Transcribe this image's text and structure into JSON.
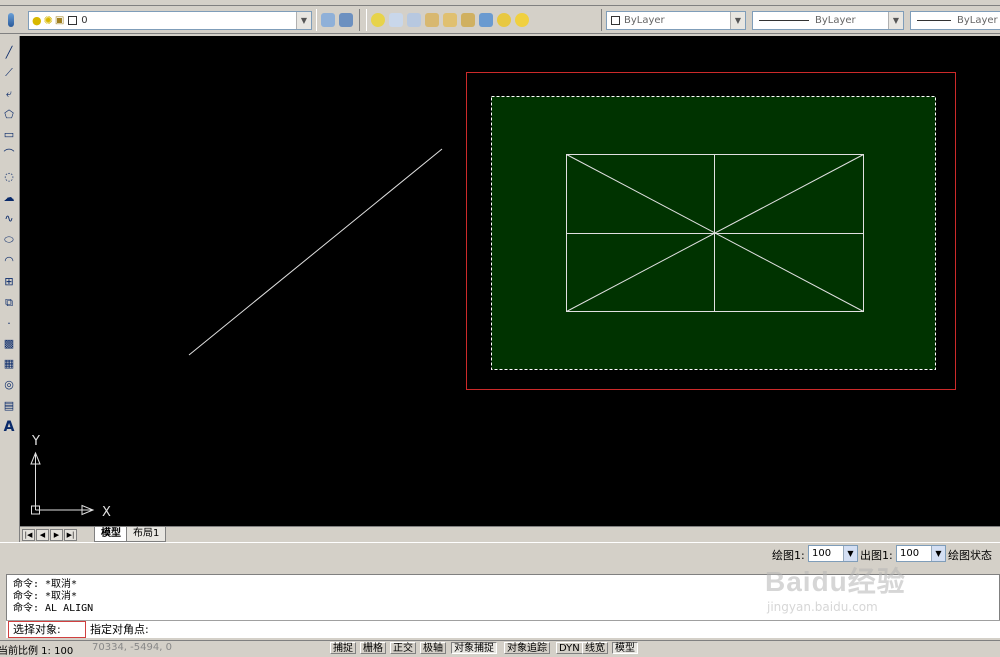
{
  "toolbar": {
    "layer_value": "0",
    "color_value": "ByLayer",
    "linetype_value": "ByLayer",
    "lineweight_value": "ByLayer"
  },
  "canvas": {
    "ucs_x_label": "X",
    "ucs_y_label": "Y",
    "colors": {
      "background": "#000000",
      "viewport_fill": "#003300",
      "paper_border": "#cc2a2a",
      "lines": "#e0e0e0"
    }
  },
  "layout_tabs": [
    {
      "label": "模型"
    },
    {
      "label": "布局1"
    }
  ],
  "viewport_bar": {
    "draw_label": "绘图1:",
    "draw_scale": "100",
    "out_label": "出图1:",
    "out_scale": "100",
    "state_label": "绘图状态"
  },
  "command": {
    "history": [
      "命令: *取消*",
      "命令: *取消*",
      "命令: AL ALIGN"
    ],
    "prompt_label": "选择对象:",
    "prompt_text": "指定对角点:"
  },
  "watermark": {
    "brand": "Baidu经验",
    "url": "jingyan.baidu.com"
  },
  "statusbar": {
    "scale_label": "当前比例 1:  100",
    "coords": "70334, -5494, 0",
    "buttons": [
      {
        "label": "捕捉",
        "on": false
      },
      {
        "label": "栅格",
        "on": false
      },
      {
        "label": "正交",
        "on": false
      },
      {
        "label": "极轴",
        "on": false
      },
      {
        "label": "对象捕捉",
        "on": true
      },
      {
        "label": "对象追踪",
        "on": false
      },
      {
        "label": "DYN",
        "on": false
      },
      {
        "label": "线宽",
        "on": false
      },
      {
        "label": "模型",
        "on": true
      }
    ]
  }
}
